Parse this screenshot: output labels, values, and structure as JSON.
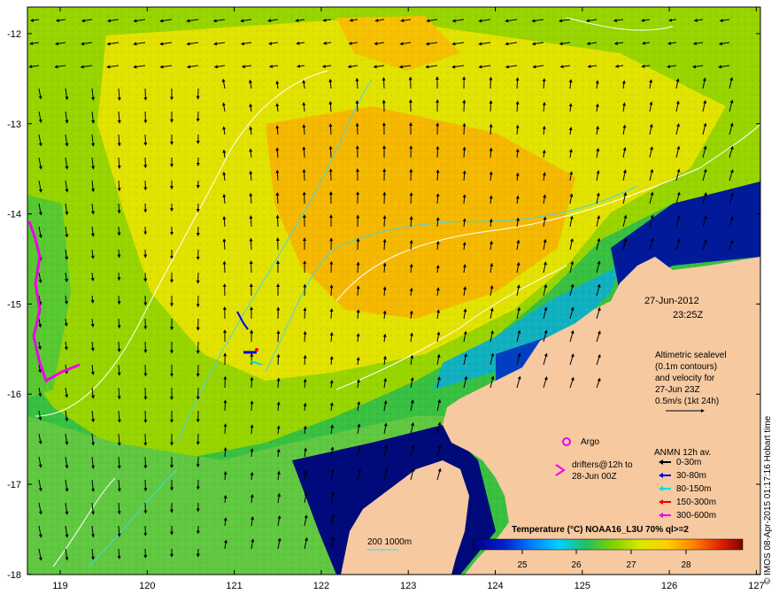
{
  "map": {
    "xaxis_ticks": [
      "119",
      "120",
      "121",
      "122",
      "123",
      "124",
      "125",
      "126",
      "127"
    ],
    "yaxis_ticks": [
      "-12",
      "-13",
      "-14",
      "-15",
      "-16",
      "-17",
      "-18"
    ],
    "date": "27-Jun-2012",
    "time": "23:25Z",
    "sealevel_note": [
      "Altimetric sealevel",
      "(0.1m contours)",
      "and velocity for",
      "27-Jun 23Z",
      "0.5m/s (1kt 24h)"
    ],
    "argo_label": "Argo",
    "drifters_label": [
      "drifters@12h to",
      "28-Jun 00Z"
    ],
    "anmn_title": "ANMN 12h av.",
    "anmn_items": [
      {
        "label": "0-30m",
        "color": "#000000"
      },
      {
        "label": "30-80m",
        "color": "#0000dd"
      },
      {
        "label": "80-150m",
        "color": "#00dddd"
      },
      {
        "label": "150-300m",
        "color": "#ee0000"
      },
      {
        "label": "300-600m",
        "color": "#ee00ee"
      }
    ],
    "bathy_label": "200  1000m",
    "colorbar_title": "Temperature (°C) NOAA16_L3U 70% ql>=2",
    "colorbar_ticks": [
      "25",
      "26",
      "27",
      "28"
    ],
    "credit": "© IMOS 08-Apr-2015 01:17:16 Hobart time"
  },
  "colors": {
    "land": "#f6c9a0",
    "deep_shelf": "#000a7a",
    "warm": "#f0c000",
    "mid": "#a8d800",
    "cool": "#30c040"
  }
}
